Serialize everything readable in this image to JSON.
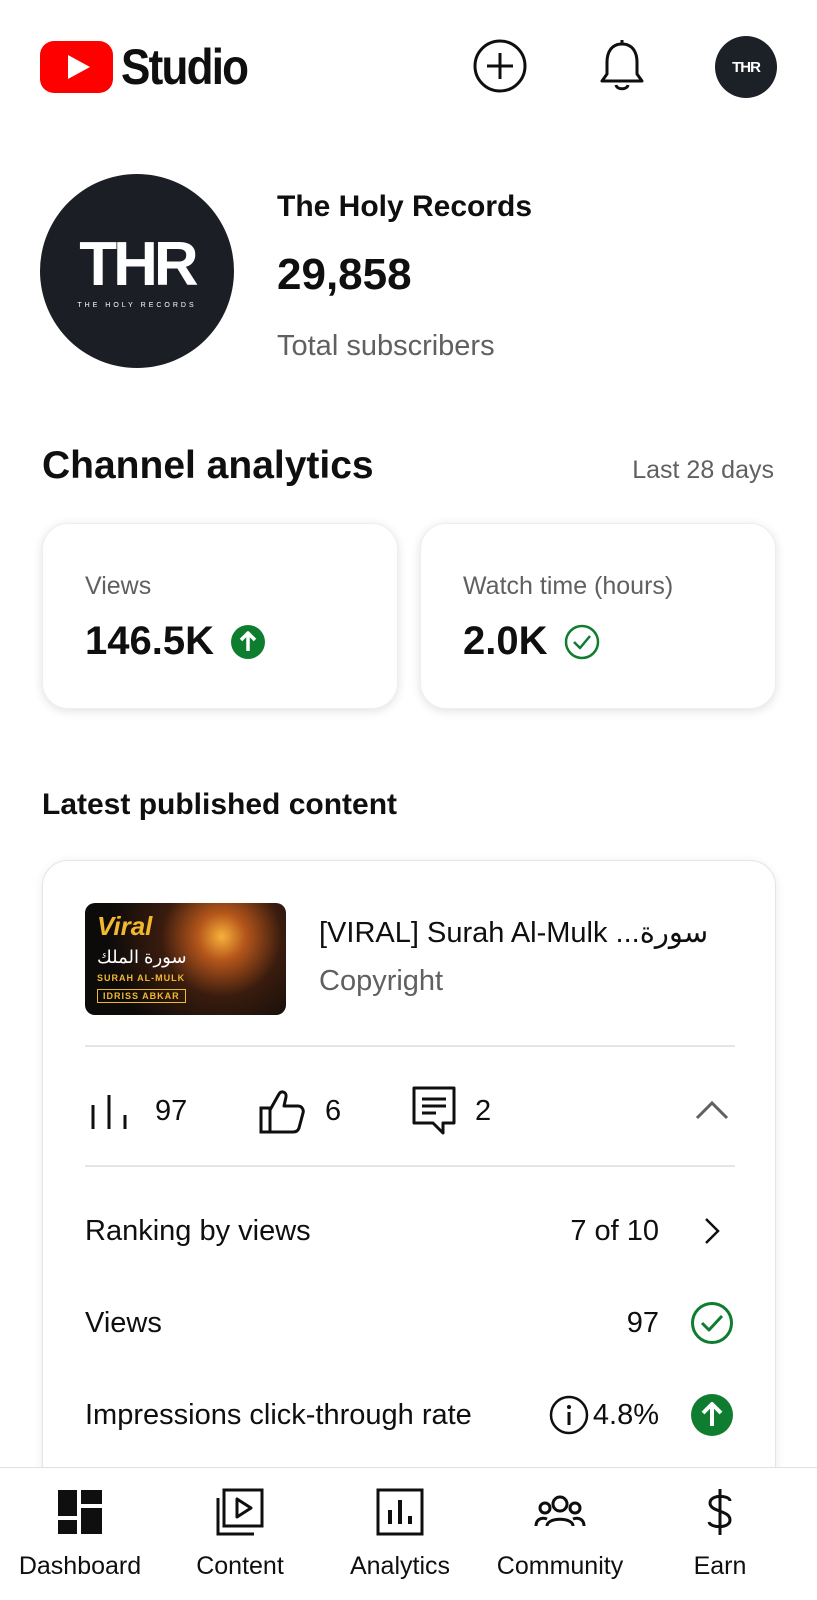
{
  "header": {
    "logo_text": "Studio",
    "avatar_initials": "THR"
  },
  "channel": {
    "avatar_monogram": "THR",
    "avatar_subtitle": "THE HOLY RECORDS",
    "name": "The Holy Records",
    "subscribers": "29,858",
    "subscribers_label": "Total subscribers"
  },
  "analytics": {
    "title": "Channel analytics",
    "range": "Last 28 days",
    "cards": [
      {
        "label": "Views",
        "value": "146.5K",
        "status": "up-arrow-icon",
        "status_color": "#0f7d2f"
      },
      {
        "label": "Watch time (hours)",
        "value": "2.0K",
        "status": "check-circle-icon",
        "status_color": "#0f7d2f"
      }
    ]
  },
  "latest": {
    "title": "Latest published content",
    "video": {
      "title": "[VIRAL] Surah Al-Mulk ...سورة",
      "status": "Copyright",
      "thumb_viral": "Viral",
      "thumb_arabic": "سورة الملك",
      "thumb_surah": "SURAH AL-MULK",
      "thumb_artist": "IDRISS ABKAR"
    },
    "metrics": {
      "views": "97",
      "likes": "6",
      "comments": "2"
    },
    "rows": [
      {
        "label": "Ranking by views",
        "value": "7 of 10"
      },
      {
        "label": "Views",
        "value": "97"
      },
      {
        "label": "Impressions click-through rate",
        "value": "4.8%"
      }
    ]
  },
  "nav": {
    "items": [
      {
        "label": "Dashboard"
      },
      {
        "label": "Content"
      },
      {
        "label": "Analytics"
      },
      {
        "label": "Community"
      },
      {
        "label": "Earn"
      }
    ]
  },
  "colors": {
    "brand_red": "#ff0000",
    "positive_green": "#0f7d2f"
  }
}
